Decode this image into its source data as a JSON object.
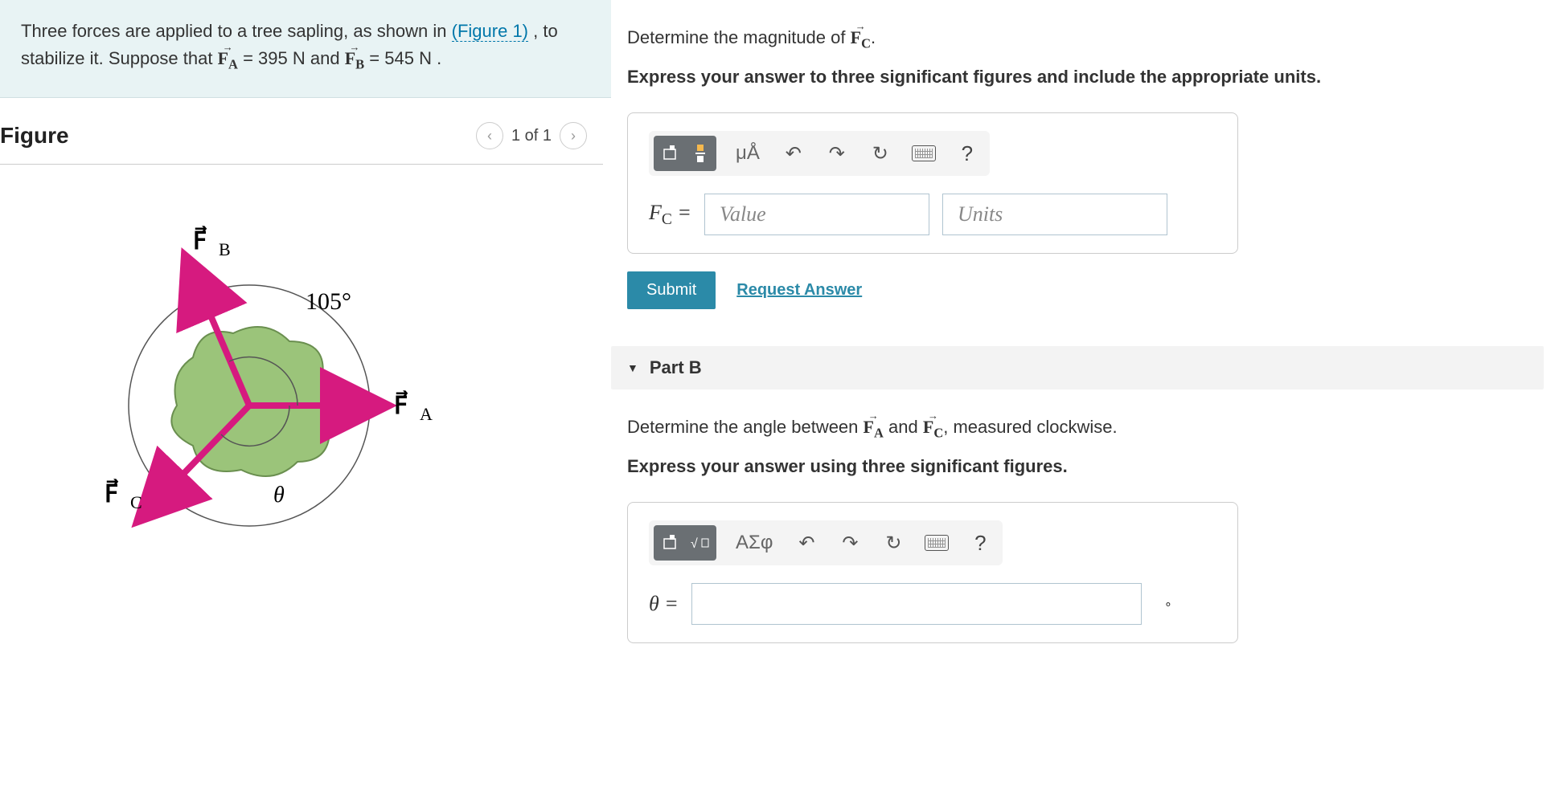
{
  "problem": {
    "intro": "Three forces are applied to a tree sapling, as shown in ",
    "figure_link": "(Figure 1)",
    "mid": " , to stabilize it. Suppose that ",
    "fa_val": " = 395  N",
    "and": " and ",
    "fb_val": " = 545  N ."
  },
  "figure": {
    "heading": "Figure",
    "pager": "1 of 1",
    "angle_label": "105°",
    "theta_label": "θ",
    "fa_label": "F",
    "fa_sub": "A",
    "fb_label": "F",
    "fb_sub": "B",
    "fc_label": "F",
    "fc_sub": "C"
  },
  "partA": {
    "prompt_pre": "Determine the magnitude of ",
    "prompt_post": ".",
    "instruction": "Express your answer to three significant figures and include the appropriate units.",
    "units_btn": "μÅ",
    "lhs": "F",
    "lhs_sub": "C",
    "eq": " = ",
    "value_ph": "Value",
    "units_ph": "Units",
    "submit": "Submit",
    "request": "Request Answer"
  },
  "partB": {
    "header": "Part B",
    "prompt_pre": "Determine the angle between ",
    "prompt_mid": " and ",
    "prompt_post": ", measured clockwise.",
    "instruction": "Express your answer using three significant figures.",
    "greek_btn": "ΑΣφ",
    "lhs": "θ = ",
    "deg": "∘"
  },
  "labels": {
    "FA": "A",
    "FB": "B",
    "FC": "C"
  }
}
